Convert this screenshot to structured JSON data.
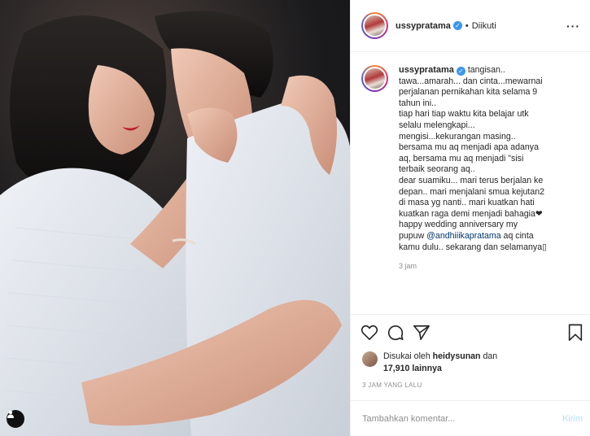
{
  "post": {
    "username": "ussypratama",
    "follow_dot": "•",
    "follow_status": "Diikuti",
    "more_icon": "more-options-icon"
  },
  "caption": {
    "username": "ussypratama",
    "lines": [
      "tangisan..",
      "tawa...amarah... dan cinta...mewarnai",
      "perjalanan pernikahan kita selama 9",
      "tahun ini..",
      "tiap hari tiap waktu kita belajar utk",
      "selalu melengkapi...",
      "mengisi...kekurangan masing..",
      "bersama mu aq menjadi apa adanya",
      "aq, bersama mu aq menjadi \"sisi",
      "terbaik seorang aq..",
      "dear suamiku... mari terus berjalan ke",
      "depan.. mari menjalani smua kejutan2",
      "di masa yg nanti.. mari kuatkan hati",
      "kuatkan raga demi menjadi bahagia❤",
      "happy wedding anniversary my"
    ],
    "mention_prefix": "pupuw ",
    "mention": "@andhiiikapratama",
    "mention_suffix": " aq cinta",
    "last_line": "kamu dulu.. sekarang dan selamanya▯",
    "time_ago": "3 jam"
  },
  "likes": {
    "prefix": "Disukai oleh ",
    "liker": "heidysunan",
    "connector": " dan",
    "count": "17,910 lainnya"
  },
  "timestamp": "3 JAM YANG LALU",
  "comment": {
    "placeholder": "Tambahkan komentar...",
    "post_label": "Kirim"
  },
  "colors": {
    "mention": "#003569",
    "verified": "#3897f0",
    "post_button": "#b2dffc"
  }
}
